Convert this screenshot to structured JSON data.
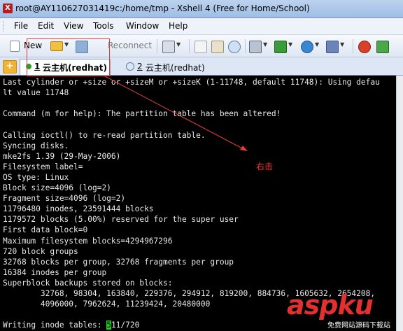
{
  "window": {
    "title": "root@AY110627031419c:/home/tmp - Xshell 4 (Free for Home/School)"
  },
  "menu": [
    "File",
    "Edit",
    "View",
    "Tools",
    "Window",
    "Help"
  ],
  "toolbar": {
    "new_label": "New",
    "reconnect_label": "Reconnect"
  },
  "tabs": [
    {
      "index": "1",
      "label": "云主机(redhat)",
      "status_color": "#2aa02a"
    },
    {
      "index": "2",
      "label": "云主机(redhat)",
      "status_color": "#888888"
    }
  ],
  "terminal": {
    "lines": [
      "Last cylinder or +size or +sizeM or +sizeK (1-11748, default 11748): Using defau",
      "lt value 11748",
      "",
      "Command (m for help): The partition table has been altered!",
      "",
      "Calling ioctl() to re-read partition table.",
      "Syncing disks.",
      "mke2fs 1.39 (29-May-2006)",
      "Filesystem label=",
      "OS type: Linux",
      "Block size=4096 (log=2)",
      "Fragment size=4096 (log=2)",
      "11796480 inodes, 23591444 blocks",
      "1179572 blocks (5.00%) reserved for the super user",
      "First data block=0",
      "Maximum filesystem blocks=4294967296",
      "720 block groups",
      "32768 blocks per group, 32768 fragments per group",
      "16384 inodes per group",
      "Superblock backups stored on blocks:",
      "        32768, 98304, 163840, 229376, 294912, 819200, 884736, 1605632, 2654208,",
      "        4096000, 7962624, 11239424, 20480000",
      "",
      ""
    ],
    "last_prefix": "Writing inode tables: ",
    "cursor_char": "5",
    "last_suffix": "11/720"
  },
  "annotation": {
    "text": "右击",
    "color": "#ff3333"
  },
  "watermark": {
    "logo": "aspku",
    "sub": "免费网站源码下载站"
  }
}
